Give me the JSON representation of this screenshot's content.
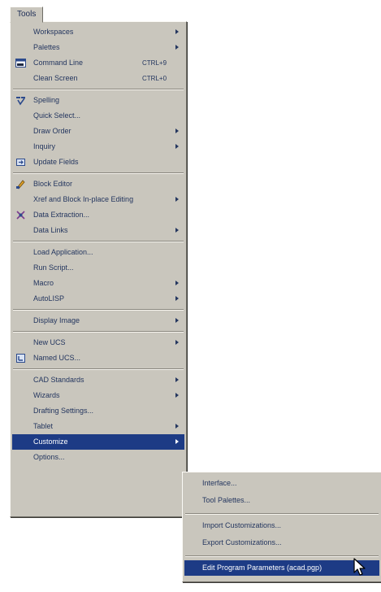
{
  "menu_title": "Tools",
  "tools_menu": {
    "items": [
      {
        "label": "Workspaces",
        "shortcut": "",
        "submenu": true
      },
      {
        "label": "Palettes",
        "shortcut": "",
        "submenu": true
      },
      {
        "label": "Command Line",
        "shortcut": "CTRL+9",
        "submenu": false,
        "icon": "command-line-icon"
      },
      {
        "label": "Clean Screen",
        "shortcut": "CTRL+0",
        "submenu": false
      },
      {
        "label": "Spelling",
        "shortcut": "",
        "submenu": false,
        "icon": "spelling-icon"
      },
      {
        "label": "Quick Select...",
        "shortcut": "",
        "submenu": false
      },
      {
        "label": "Draw Order",
        "shortcut": "",
        "submenu": true
      },
      {
        "label": "Inquiry",
        "shortcut": "",
        "submenu": true
      },
      {
        "label": "Update Fields",
        "shortcut": "",
        "submenu": false,
        "icon": "update-fields-icon"
      },
      {
        "label": "Block Editor",
        "shortcut": "",
        "submenu": false,
        "icon": "block-editor-icon"
      },
      {
        "label": "Xref and Block In-place Editing",
        "shortcut": "",
        "submenu": true
      },
      {
        "label": "Data Extraction...",
        "shortcut": "",
        "submenu": false,
        "icon": "data-extraction-icon"
      },
      {
        "label": "Data Links",
        "shortcut": "",
        "submenu": true
      },
      {
        "label": "Load Application...",
        "shortcut": "",
        "submenu": false
      },
      {
        "label": "Run Script...",
        "shortcut": "",
        "submenu": false
      },
      {
        "label": "Macro",
        "shortcut": "",
        "submenu": true
      },
      {
        "label": "AutoLISP",
        "shortcut": "",
        "submenu": true
      },
      {
        "label": "Display Image",
        "shortcut": "",
        "submenu": true
      },
      {
        "label": "New UCS",
        "shortcut": "",
        "submenu": true
      },
      {
        "label": "Named UCS...",
        "shortcut": "",
        "submenu": false,
        "icon": "named-ucs-icon"
      },
      {
        "label": "CAD Standards",
        "shortcut": "",
        "submenu": true
      },
      {
        "label": "Wizards",
        "shortcut": "",
        "submenu": true
      },
      {
        "label": "Drafting Settings...",
        "shortcut": "",
        "submenu": false
      },
      {
        "label": "Tablet",
        "shortcut": "",
        "submenu": true
      },
      {
        "label": "Customize",
        "shortcut": "",
        "submenu": true,
        "selected": true
      },
      {
        "label": "Options...",
        "shortcut": "",
        "submenu": false
      }
    ]
  },
  "customize_submenu": {
    "items": [
      {
        "label": "Interface..."
      },
      {
        "label": "Tool Palettes..."
      },
      {
        "label": "Import Customizations..."
      },
      {
        "label": "Export Customizations..."
      },
      {
        "label": "Edit Program Parameters (acad.pgp)",
        "selected": true
      }
    ]
  },
  "colors": {
    "menu_background": "#c9c6bd",
    "selection": "#1d3b85",
    "text": "#24365f"
  }
}
